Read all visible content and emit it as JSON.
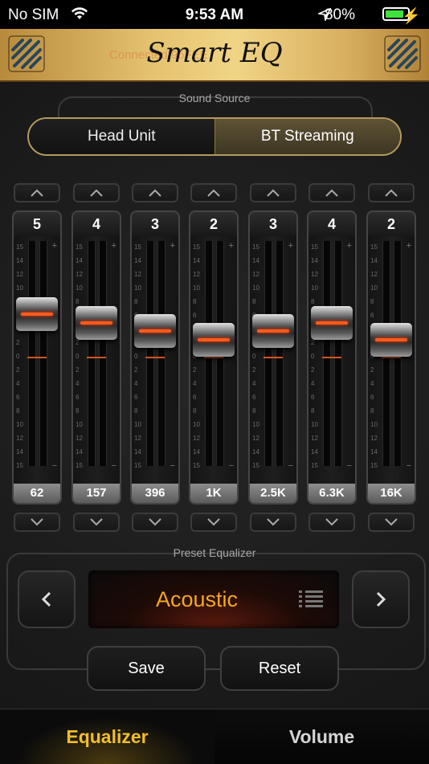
{
  "status_bar": {
    "carrier": "No SIM",
    "time": "9:53 AM",
    "battery_percent": "80%"
  },
  "header": {
    "title": "Smart EQ",
    "connection_text": "Connected 96FEE"
  },
  "sound_source": {
    "label": "Sound Source",
    "options": [
      "Head Unit",
      "BT Streaming"
    ],
    "selected": "BT Streaming"
  },
  "equalizer": {
    "scale": [
      "15",
      "14",
      "12",
      "10",
      "8",
      "6",
      "4",
      "2",
      "0",
      "2",
      "4",
      "6",
      "8",
      "10",
      "12",
      "14",
      "15"
    ],
    "bands": [
      {
        "freq": "62",
        "value": "5"
      },
      {
        "freq": "157",
        "value": "4"
      },
      {
        "freq": "396",
        "value": "3"
      },
      {
        "freq": "1K",
        "value": "2"
      },
      {
        "freq": "2.5K",
        "value": "3"
      },
      {
        "freq": "6.3K",
        "value": "4"
      },
      {
        "freq": "16K",
        "value": "2"
      }
    ]
  },
  "preset": {
    "label": "Preset Equalizer",
    "name": "Acoustic",
    "save_label": "Save",
    "reset_label": "Reset"
  },
  "tabs": {
    "equalizer": "Equalizer",
    "volume": "Volume",
    "active": "equalizer"
  },
  "colors": {
    "accent": "#f2a81e",
    "knob_line": "#ff5a1e",
    "gold_header": "#e4c26f"
  }
}
